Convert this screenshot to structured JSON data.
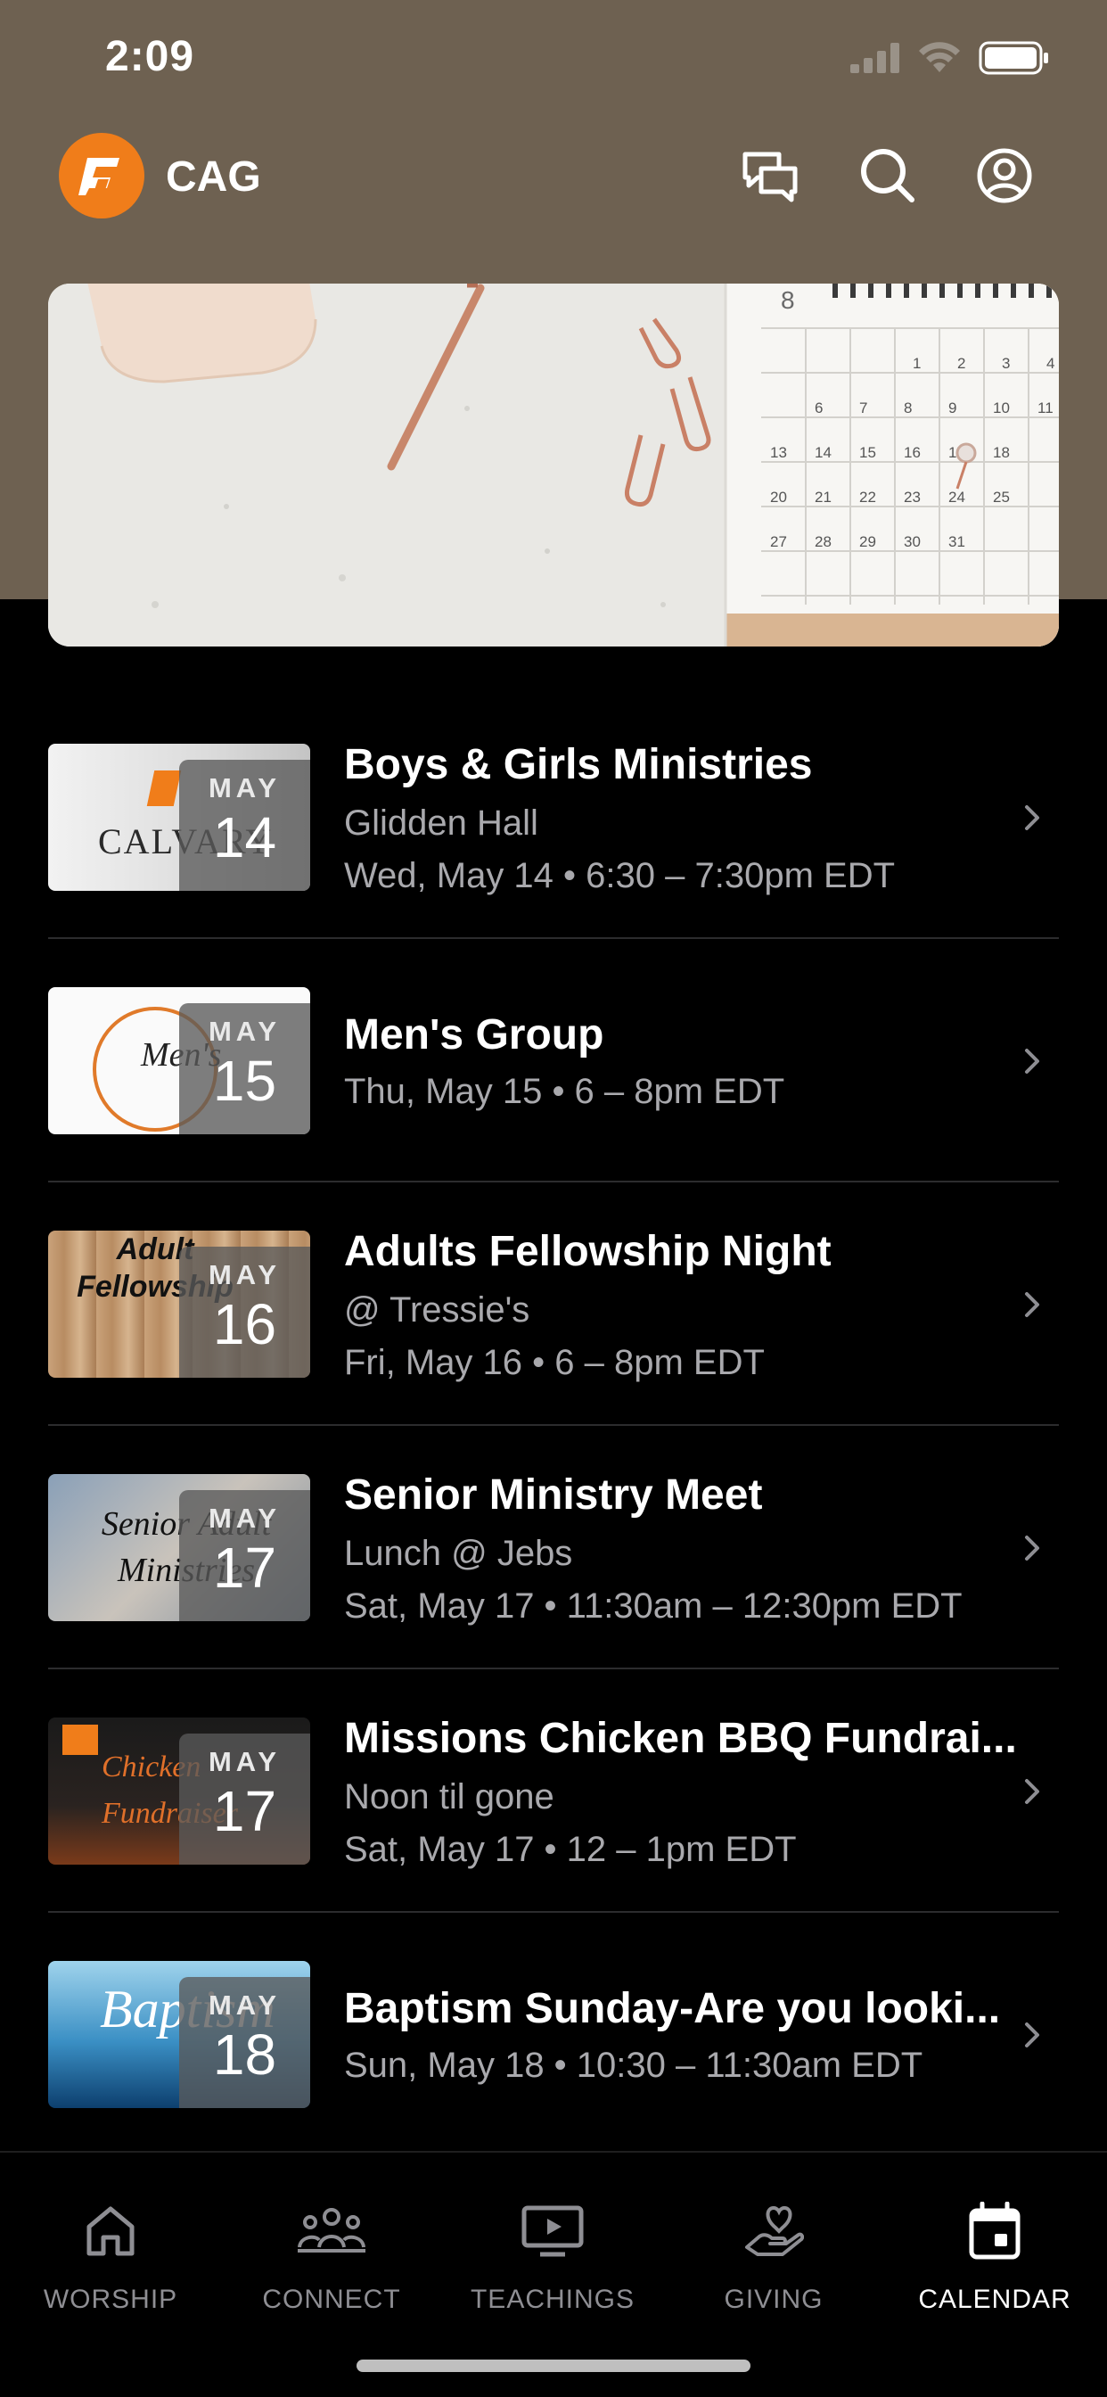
{
  "status_bar": {
    "time": "2:09"
  },
  "app": {
    "title": "CAG",
    "brand_color": "#f07d1a",
    "header_color": "#6e6151"
  },
  "hero": {
    "calendar_month_number": "8",
    "calendar_days": [
      "1",
      "2",
      "3",
      "4",
      "6",
      "7",
      "8",
      "9",
      "10",
      "11",
      "13",
      "14",
      "15",
      "16",
      "17",
      "18",
      "20",
      "21",
      "22",
      "23",
      "24",
      "25",
      "27",
      "28",
      "29",
      "30",
      "31"
    ]
  },
  "events": [
    {
      "month": "MAY",
      "day": "14",
      "title": "Boys & Girls Ministries",
      "subtitle": "Glidden Hall",
      "when": "Wed, May 14 • 6:30 – 7:30pm EDT",
      "thumb_text": "CALVARY"
    },
    {
      "month": "MAY",
      "day": "15",
      "title": "Men's Group",
      "subtitle": "",
      "when": "Thu, May 15 • 6 – 8pm EDT",
      "thumb_text": "Men's"
    },
    {
      "month": "MAY",
      "day": "16",
      "title": "Adults Fellowship Night",
      "subtitle": "@ Tressie's",
      "when": "Fri, May 16 • 6 – 8pm EDT",
      "thumb_text": "Adult Fellowship"
    },
    {
      "month": "MAY",
      "day": "17",
      "title": "Senior Ministry Meet",
      "subtitle": "Lunch @ Jebs",
      "when": "Sat, May 17 • 11:30am – 12:30pm EDT",
      "thumb_text": "Senior Adult Ministries"
    },
    {
      "month": "MAY",
      "day": "17",
      "title": "Missions Chicken BBQ Fundrai...",
      "subtitle": "Noon til gone",
      "when": "Sat, May 17 • 12 – 1pm EDT",
      "thumb_text": "Chicken Fundraiser"
    },
    {
      "month": "MAY",
      "day": "18",
      "title": "Baptism Sunday-Are you looki...",
      "subtitle": "",
      "when": "Sun, May 18 • 10:30 – 11:30am EDT",
      "thumb_text": "Baptism"
    }
  ],
  "tabs": [
    {
      "label": "WORSHIP",
      "icon": "home-icon"
    },
    {
      "label": "CONNECT",
      "icon": "people-icon"
    },
    {
      "label": "TEACHINGS",
      "icon": "tv-play-icon"
    },
    {
      "label": "GIVING",
      "icon": "hand-heart-icon"
    },
    {
      "label": "CALENDAR",
      "icon": "calendar-icon",
      "active": true
    }
  ]
}
